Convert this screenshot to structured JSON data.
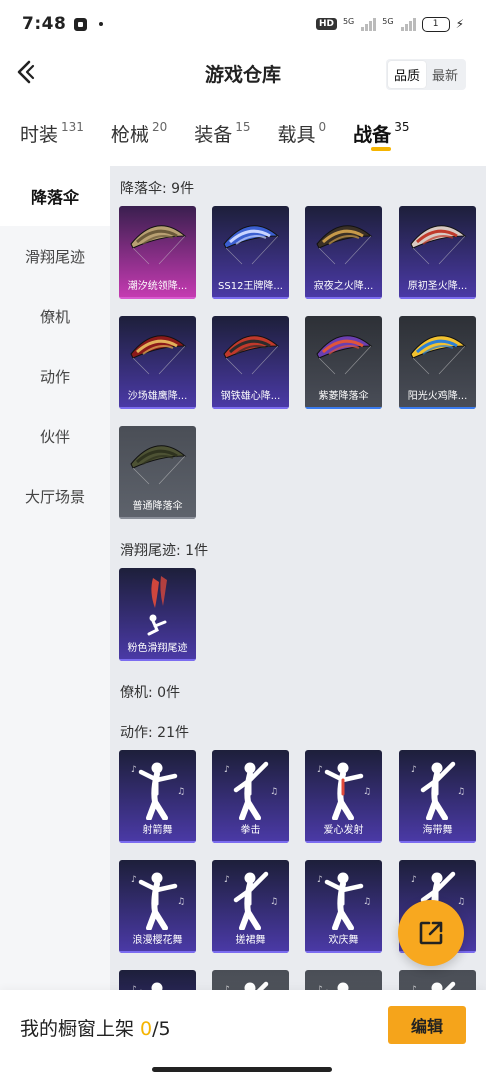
{
  "status": {
    "time": "7:48",
    "hd": "HD",
    "net1": "5G",
    "net2": "5G",
    "battery": "1"
  },
  "header": {
    "title": "游戏仓库",
    "sort_options": [
      "品质",
      "最新"
    ],
    "sort_active": 0
  },
  "categories": [
    {
      "label": "时装",
      "count": "131"
    },
    {
      "label": "枪械",
      "count": "20"
    },
    {
      "label": "装备",
      "count": "15"
    },
    {
      "label": "载具",
      "count": "0"
    },
    {
      "label": "战备",
      "count": "35"
    }
  ],
  "active_category": 4,
  "sidebar": {
    "items": [
      "降落伞",
      "滑翔尾迹",
      "僚机",
      "动作",
      "伙伴",
      "大厅场景"
    ],
    "active": 0
  },
  "sections": [
    {
      "title": "降落伞: 9件",
      "items": [
        {
          "name": "潮汐统领降...",
          "rarity": "legendary",
          "icon": "parachute-icon",
          "colors": [
            "#b8a072",
            "#6b5a3a"
          ]
        },
        {
          "name": "SS12王牌降...",
          "rarity": "epic",
          "icon": "parachute-icon",
          "colors": [
            "#3b5fd0",
            "#c9d4ff"
          ]
        },
        {
          "name": "寂夜之火降...",
          "rarity": "epic",
          "icon": "parachute-icon",
          "colors": [
            "#3a3026",
            "#c79a4a"
          ]
        },
        {
          "name": "原初圣火降...",
          "rarity": "epic",
          "icon": "parachute-icon",
          "colors": [
            "#d8c9c2",
            "#c03a2b"
          ]
        },
        {
          "name": "沙场雄鹰降...",
          "rarity": "epic",
          "icon": "parachute-icon",
          "colors": [
            "#8b1a1a",
            "#e2b15a"
          ]
        },
        {
          "name": "钢铁雄心降...",
          "rarity": "epic",
          "icon": "parachute-icon",
          "colors": [
            "#c0392b",
            "#2c2c2c"
          ]
        },
        {
          "name": "紫菱降落伞",
          "rarity": "rare",
          "icon": "parachute-icon",
          "colors": [
            "#6b3fb0",
            "#e0553a"
          ]
        },
        {
          "name": "阳光火鸡降...",
          "rarity": "rare",
          "icon": "parachute-icon",
          "colors": [
            "#f2c230",
            "#2b7fd6"
          ]
        },
        {
          "name": "普通降落伞",
          "rarity": "common",
          "icon": "parachute-icon",
          "colors": [
            "#4d5234",
            "#2f331f"
          ]
        }
      ]
    },
    {
      "title": "滑翔尾迹: 1件",
      "items": [
        {
          "name": "粉色滑翔尾迹",
          "rarity": "epic",
          "icon": "glide-trail-icon",
          "colors": [
            "#e24a3b",
            "#ffffff"
          ]
        }
      ]
    },
    {
      "title": "僚机: 0件",
      "items": []
    },
    {
      "title": "动作: 21件",
      "items": [
        {
          "name": "射箭舞",
          "rarity": "epic",
          "icon": "dance-figure-icon",
          "colors": [
            "#ffffff",
            "#ffffff"
          ]
        },
        {
          "name": "拳击",
          "rarity": "epic",
          "icon": "dance-figure-icon",
          "colors": [
            "#ffffff",
            "#ffffff"
          ]
        },
        {
          "name": "爱心发射",
          "rarity": "epic",
          "icon": "dance-figure-icon",
          "colors": [
            "#ffffff",
            "#e24a3b"
          ]
        },
        {
          "name": "海带舞",
          "rarity": "epic",
          "icon": "dance-figure-icon",
          "colors": [
            "#ffffff",
            "#ffffff"
          ]
        },
        {
          "name": "浪漫樱花舞",
          "rarity": "epic",
          "icon": "dance-figure-icon",
          "colors": [
            "#ffffff",
            "#ffffff"
          ]
        },
        {
          "name": "搓裙舞",
          "rarity": "epic",
          "icon": "dance-figure-icon",
          "colors": [
            "#ffffff",
            "#ffffff"
          ]
        },
        {
          "name": "欢庆舞",
          "rarity": "epic",
          "icon": "dance-figure-icon",
          "colors": [
            "#ffffff",
            "#ffffff"
          ]
        },
        {
          "name": "",
          "rarity": "epic",
          "icon": "dance-figure-icon",
          "colors": [
            "#ffffff",
            "#ffffff"
          ]
        },
        {
          "name": "",
          "rarity": "epic",
          "icon": "dance-figure-icon",
          "colors": [
            "#ffffff",
            "#ffffff"
          ]
        },
        {
          "name": "",
          "rarity": "common",
          "icon": "dance-figure-icon",
          "colors": [
            "#ffffff",
            "#ffffff"
          ]
        },
        {
          "name": "",
          "rarity": "common",
          "icon": "dance-figure-icon",
          "colors": [
            "#ffffff",
            "#ffffff"
          ]
        },
        {
          "name": "",
          "rarity": "common",
          "icon": "dance-figure-icon",
          "colors": [
            "#ffffff",
            "#ffffff"
          ]
        }
      ]
    }
  ],
  "rarity_colors": {
    "legendary": {
      "top": "#3a1f4f",
      "bottom": "#c73bb3",
      "bar": "#d85ad0"
    },
    "epic": {
      "top": "#1d1f3a",
      "bottom": "#4b3aa8",
      "bar": "#7b6cf0"
    },
    "rare": {
      "top": "#2d3036",
      "bottom": "#4a4e58",
      "bar": "#3a7bf0"
    },
    "common": {
      "top": "#4a4e56",
      "bottom": "#5e636c",
      "bar": "#8a8f99"
    }
  },
  "bottom": {
    "shelf_label": "我的橱窗上架 ",
    "shelf_current": "0",
    "shelf_total": "/5",
    "edit_label": "编辑"
  },
  "icons": {
    "back": "back-chevron-icon",
    "share": "share-external-icon"
  }
}
